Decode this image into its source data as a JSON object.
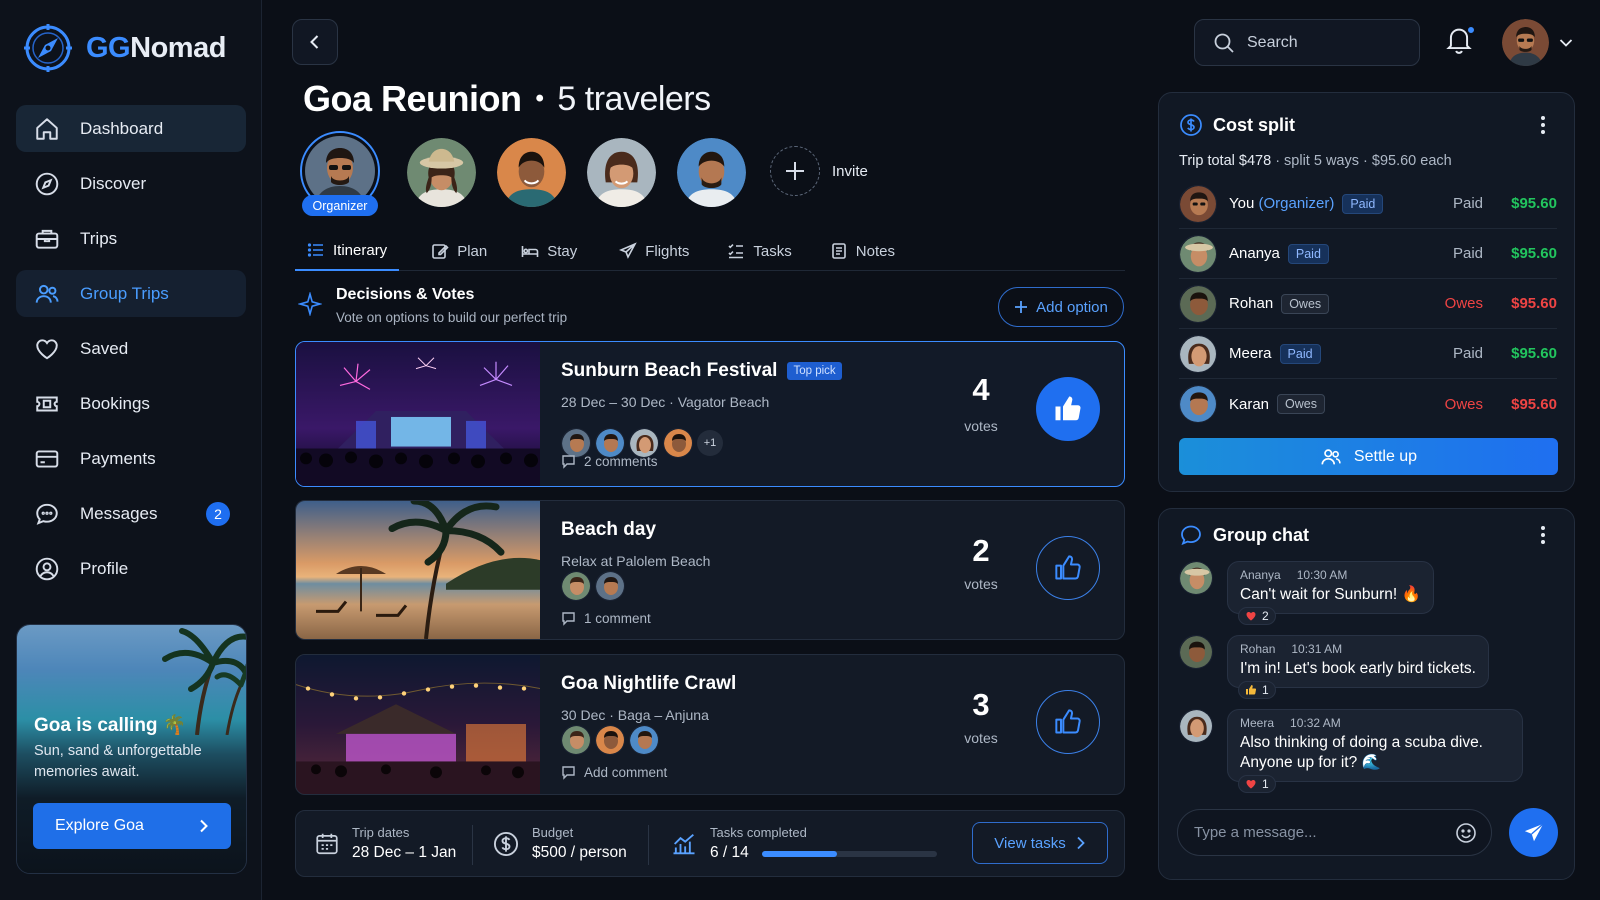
{
  "brand": {
    "prefix": "GG",
    "suffix": "Nomad"
  },
  "sidebar": {
    "items": [
      {
        "label": "Dashboard",
        "icon": "home-icon"
      },
      {
        "label": "Discover",
        "icon": "compass-icon"
      },
      {
        "label": "Trips",
        "icon": "briefcase-icon"
      },
      {
        "label": "Group Trips",
        "icon": "users-icon"
      },
      {
        "label": "Saved",
        "icon": "heart-icon"
      },
      {
        "label": "Bookings",
        "icon": "ticket-icon"
      },
      {
        "label": "Payments",
        "icon": "card-icon"
      },
      {
        "label": "Messages",
        "icon": "chat-icon",
        "badge": "2"
      },
      {
        "label": "Profile",
        "icon": "user-circle-icon"
      }
    ],
    "promo": {
      "title": "Goa is calling 🌴",
      "subtitle": "Sun, sand & unforgettable memories await.",
      "button": "Explore Goa"
    }
  },
  "header": {
    "title": "Goa Reunion",
    "separator": "•",
    "traveler_count": "5 travelers",
    "organizer_label": "Organizer",
    "invite_label": "Invite",
    "search_placeholder": "Search"
  },
  "tabs": [
    "Itinerary",
    "Plan",
    "Stay",
    "Flights",
    "Tasks",
    "Notes"
  ],
  "decisions": {
    "title": "Decisions & Votes",
    "subtitle": "Vote on options to build our perfect trip",
    "add_option": "Add option",
    "votes_label": "votes",
    "options": [
      {
        "title": "Sunburn Beach Festival",
        "tag": "Top pick",
        "subtitle": "28 Dec – 30 Dec  ·  Vagator Beach",
        "votes": "4",
        "extra_voters": "+1",
        "comments": "2 comments"
      },
      {
        "title": "Beach day",
        "subtitle": "Relax at Palolem Beach",
        "votes": "2",
        "comments": "1 comment"
      },
      {
        "title": "Goa Nightlife Crawl",
        "subtitle": "30 Dec  ·  Baga – Anjuna",
        "votes": "3",
        "comments": "Add comment"
      }
    ]
  },
  "footer": {
    "trip_dates_label": "Trip dates",
    "trip_dates": "28 Dec – 1 Jan",
    "budget_label": "Budget",
    "budget": "$500 / person",
    "tasks_label": "Tasks completed",
    "tasks": "6 / 14",
    "tasks_progress": 0.43,
    "view_tasks": "View tasks"
  },
  "cost_split": {
    "title": "Cost split",
    "total": "Trip total $478",
    "split_info": "split 5 ways",
    "each": "$95.60 each",
    "members": [
      {
        "name": "You",
        "role": "(Organizer)",
        "pill": "Paid",
        "status": "Paid",
        "amount": "$95.60"
      },
      {
        "name": "Ananya",
        "pill": "Paid",
        "status": "Paid",
        "amount": "$95.60"
      },
      {
        "name": "Rohan",
        "pill": "Owes",
        "status": "Owes",
        "amount": "$95.60"
      },
      {
        "name": "Meera",
        "pill": "Paid",
        "status": "Paid",
        "amount": "$95.60"
      },
      {
        "name": "Karan",
        "pill": "Owes",
        "status": "Owes",
        "amount": "$95.60"
      }
    ],
    "settle_up": "Settle up"
  },
  "chat": {
    "title": "Group chat",
    "messages": [
      {
        "author": "Ananya",
        "time": "10:30 AM",
        "text": "Can't wait for Sunburn! 🔥",
        "reaction": "2",
        "reaction_icon": "heart"
      },
      {
        "author": "Rohan",
        "time": "10:31 AM",
        "text": "I'm in! Let's book early bird tickets.",
        "reaction": "1",
        "reaction_icon": "thumbs-up"
      },
      {
        "author": "Meera",
        "time": "10:32 AM",
        "text": "Also thinking of doing a scuba dive. Anyone up for it? 🌊",
        "reaction": "1",
        "reaction_icon": "heart"
      }
    ],
    "input_placeholder": "Type a message..."
  },
  "colors": {
    "accent": "#3b8cff",
    "paid": "#22c55e",
    "owes": "#ef4444",
    "background": "#0b0f17"
  }
}
